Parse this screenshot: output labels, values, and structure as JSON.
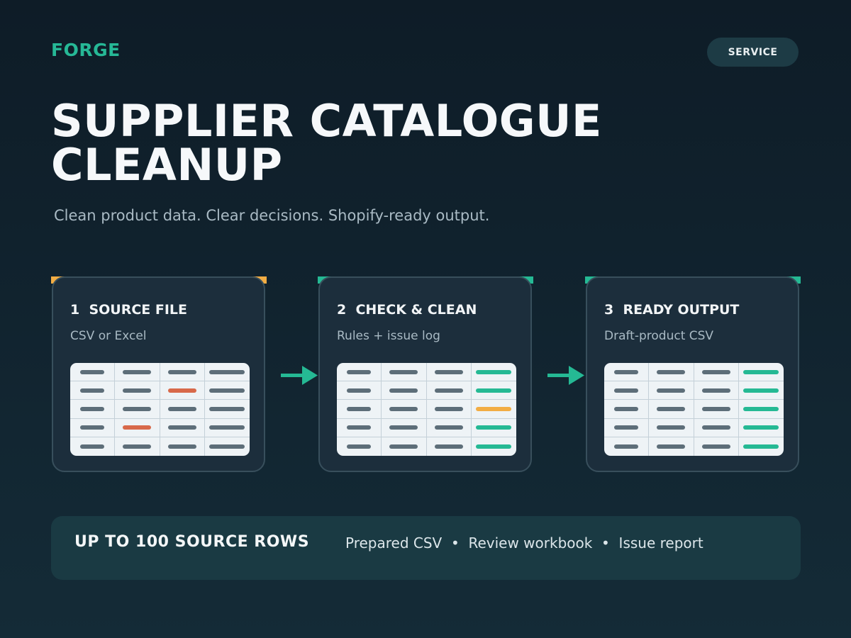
{
  "brand": "FORGE",
  "badge": "SERVICE",
  "title": "SUPPLIER CATALOGUE CLEANUP",
  "subtitle": "Clean product data. Clear decisions. Shopify-ready output.",
  "colors": {
    "accent": "#26b896",
    "step1_bar": "#f2ad44",
    "step_bar": "#25b994",
    "issue": "#d8694a",
    "warning": "#f2ad44",
    "ok": "#25b994"
  },
  "steps": [
    {
      "title": "1  SOURCE FILE",
      "subtitle": "CSV or Excel",
      "cells": [
        [
          "gray",
          "gray",
          "gray",
          "gray"
        ],
        [
          "gray",
          "gray",
          "orange",
          "gray"
        ],
        [
          "gray",
          "gray",
          "gray",
          "gray"
        ],
        [
          "gray",
          "orange",
          "gray",
          "gray"
        ],
        [
          "gray",
          "gray",
          "gray",
          "gray"
        ]
      ]
    },
    {
      "title": "2  CHECK & CLEAN",
      "subtitle": "Rules + issue log",
      "cells": [
        [
          "gray",
          "gray",
          "gray",
          "green"
        ],
        [
          "gray",
          "gray",
          "gray",
          "green"
        ],
        [
          "gray",
          "gray",
          "gray",
          "amber"
        ],
        [
          "gray",
          "gray",
          "gray",
          "green"
        ],
        [
          "gray",
          "gray",
          "gray",
          "green"
        ]
      ]
    },
    {
      "title": "3  READY OUTPUT",
      "subtitle": "Draft-product CSV",
      "cells": [
        [
          "gray",
          "gray",
          "gray",
          "green"
        ],
        [
          "gray",
          "gray",
          "gray",
          "green"
        ],
        [
          "gray",
          "gray",
          "gray",
          "green"
        ],
        [
          "gray",
          "gray",
          "gray",
          "green"
        ],
        [
          "gray",
          "gray",
          "gray",
          "green"
        ]
      ]
    }
  ],
  "footer": {
    "headline": "UP TO 100 SOURCE ROWS",
    "deliverables": "Prepared CSV  •  Review workbook  •  Issue report"
  }
}
